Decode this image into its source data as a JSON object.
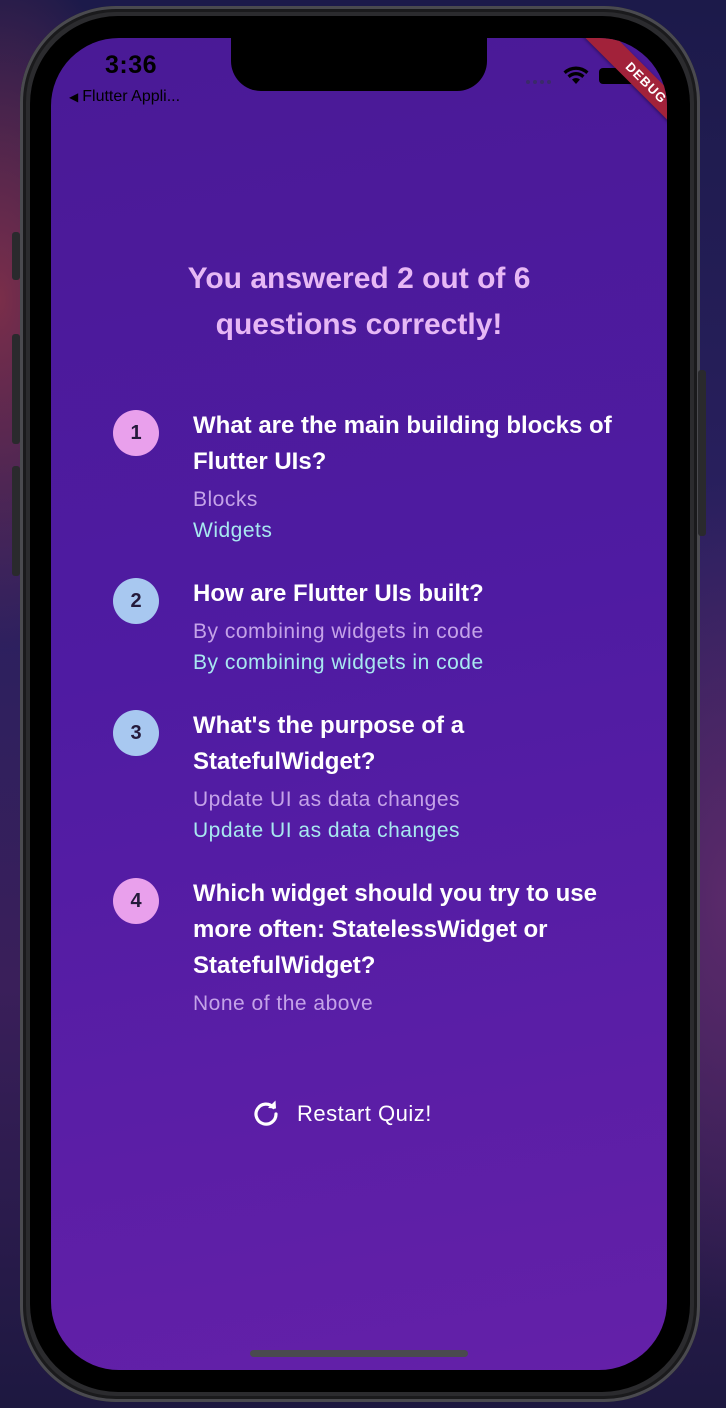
{
  "status_bar": {
    "time": "3:36",
    "back_app": "Flutter Appli...",
    "back_arrow": "◀"
  },
  "debug_banner": "DEBUG",
  "result": {
    "title": "You answered 2 out of 6 questions correctly!"
  },
  "summary": [
    {
      "index": "1",
      "question": "What are the main building blocks of Flutter UIs?",
      "user_answer": "Blocks",
      "correct_answer": "Widgets",
      "is_correct": false
    },
    {
      "index": "2",
      "question": "How are Flutter UIs built?",
      "user_answer": "By combining widgets in code",
      "correct_answer": "By combining widgets in code",
      "is_correct": true
    },
    {
      "index": "3",
      "question": "What's the purpose of a StatefulWidget?",
      "user_answer": "Update UI as data changes",
      "correct_answer": "Update UI as data changes",
      "is_correct": true
    },
    {
      "index": "4",
      "question": "Which widget should you try to use more often: StatelessWidget or StatefulWidget?",
      "user_answer": "None of the above",
      "correct_answer": "",
      "is_correct": false
    }
  ],
  "restart": {
    "label": "Restart Quiz!",
    "icon": "refresh-icon"
  },
  "colors": {
    "background_top": "#4a1a96",
    "background_bottom": "#6420a8",
    "title": "#e7b8f5",
    "wrong_badge": "#e9a0ec",
    "right_badge": "#a8c8f0",
    "user_answer": "#c4a3e8",
    "correct_answer": "#a8e8f0",
    "debug_banner": "#a2223a"
  }
}
